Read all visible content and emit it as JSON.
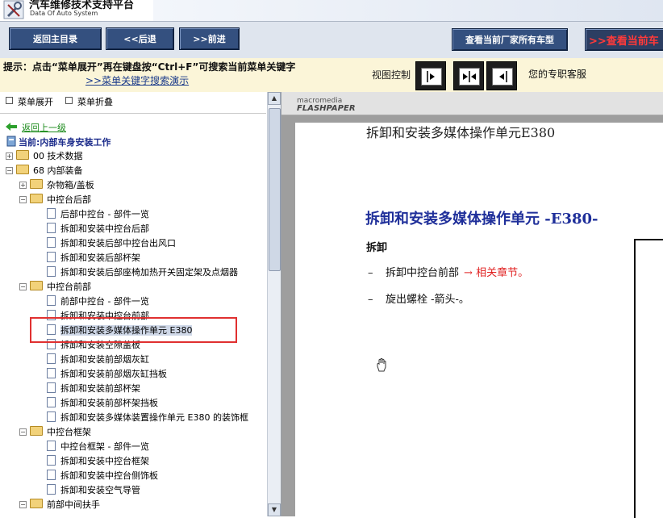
{
  "header": {
    "title": "汽车维修技术支持平台",
    "subtitle": "Data Of Auto System"
  },
  "toolbar": {
    "home_label": "返回主目录",
    "back_label": "<<后退",
    "forward_label": ">>前进",
    "all_models_label": "查看当前厂家所有车型",
    "current_model_label": ">>查看当前车"
  },
  "hint": {
    "text": "提示：点击“菜单展开”再在键盘按“Ctrl+F”可搜索当前菜单关键字",
    "link": ">>菜单关键字搜索演示",
    "view_control_label": "视图控制",
    "support_label": "您的专职客服"
  },
  "tree": {
    "expand_label": "菜单展开",
    "collapse_label": "菜单折叠",
    "back_link": "返回上一级",
    "current_path": "当前:内部车身安装工作",
    "items": [
      {
        "label": "00 技术数据",
        "type": "folder",
        "expander": "+"
      },
      {
        "label": "68 内部装备",
        "type": "folder",
        "expander": "−"
      },
      {
        "label": "杂物箱/盖板",
        "type": "folder",
        "expander": "+"
      },
      {
        "label": "中控台后部",
        "type": "folder",
        "expander": "−"
      },
      {
        "label": "后部中控台 - 部件一览",
        "type": "doc"
      },
      {
        "label": "拆卸和安装中控台后部",
        "type": "doc"
      },
      {
        "label": "拆卸和安装后部中控台出风口",
        "type": "doc"
      },
      {
        "label": "拆卸和安装后部杯架",
        "type": "doc"
      },
      {
        "label": "拆卸和安装后部座椅加热开关固定架及点烟器",
        "type": "doc"
      },
      {
        "label": "中控台前部",
        "type": "folder",
        "expander": "−"
      },
      {
        "label": "前部中控台 - 部件一览",
        "type": "doc"
      },
      {
        "label": "拆卸和安装中控台前部",
        "type": "doc"
      },
      {
        "label": "拆卸和安装多媒体操作单元 E380",
        "type": "doc"
      },
      {
        "label": "拆卸和安装空隙盖板",
        "type": "doc"
      },
      {
        "label": "拆卸和安装前部烟灰缸",
        "type": "doc"
      },
      {
        "label": "拆卸和安装前部烟灰缸挡板",
        "type": "doc"
      },
      {
        "label": "拆卸和安装前部杯架",
        "type": "doc"
      },
      {
        "label": "拆卸和安装前部杯架挡板",
        "type": "doc"
      },
      {
        "label": "拆卸和安装多媒体装置操作单元 E380 的装饰框",
        "type": "doc"
      },
      {
        "label": "中控台框架",
        "type": "folder",
        "expander": "−"
      },
      {
        "label": "中控台框架 - 部件一览",
        "type": "doc"
      },
      {
        "label": "拆卸和安装中控台框架",
        "type": "doc"
      },
      {
        "label": "拆卸和安装中控台侧饰板",
        "type": "doc"
      },
      {
        "label": "拆卸和安装空气导管",
        "type": "doc"
      },
      {
        "label": "前部中间扶手",
        "type": "folder",
        "expander": "−"
      }
    ]
  },
  "document": {
    "brand_top": "macromedia",
    "brand_bottom": "FLASHPAPER",
    "header_title": "拆卸和安装多媒体操作单元E380",
    "title": "拆卸和安装多媒体操作单元 -E380-",
    "section": "拆卸",
    "step1_text": "拆卸中控台前部",
    "step1_arrow": "→",
    "step1_ref": "相关章节。",
    "step2_text": "旋出螺栓 -箭头-。",
    "dash": "–"
  },
  "colors": {
    "toolbar_button": "#34507f",
    "hint_background": "#fbf5d8",
    "doc_title": "#1f2f9a",
    "link_red": "#e02020",
    "selection_outline": "#e03030"
  }
}
